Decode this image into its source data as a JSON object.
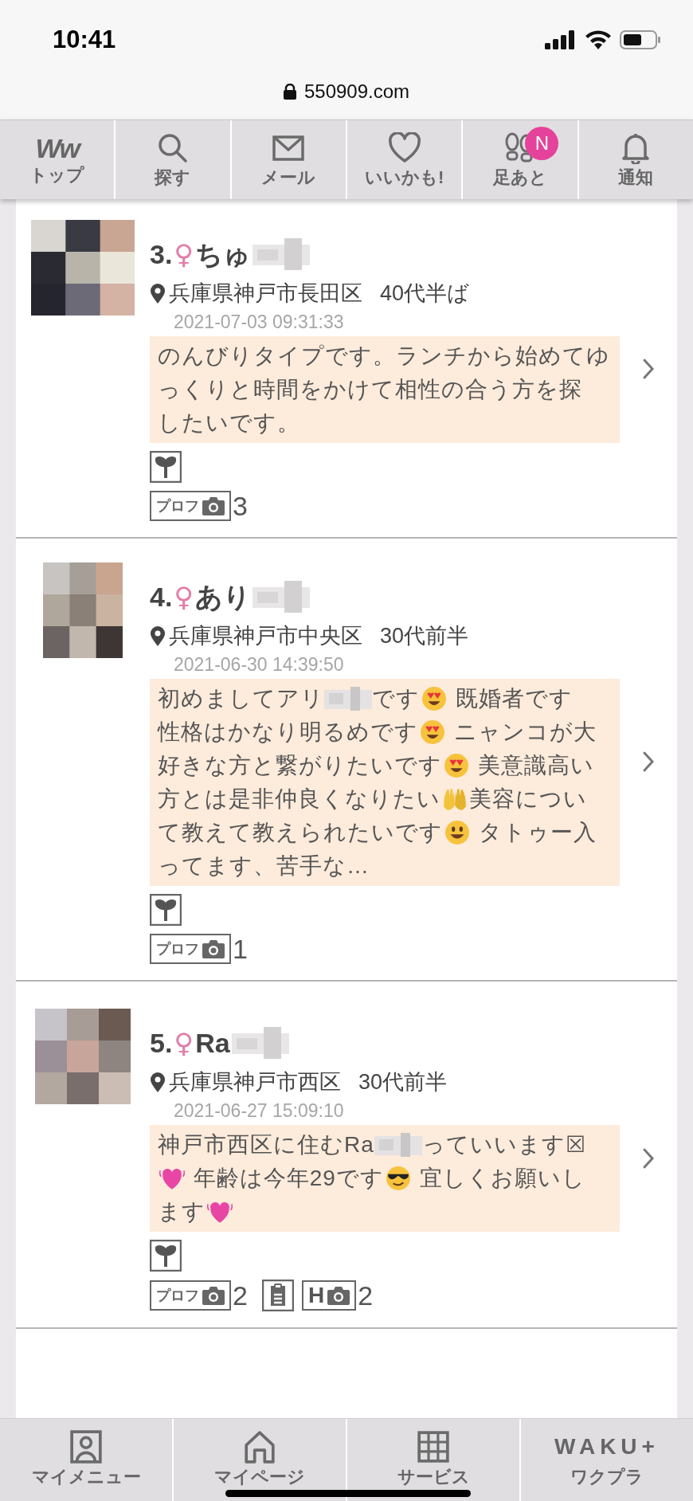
{
  "status_bar": {
    "time": "10:41"
  },
  "address_bar": {
    "url": "550909.com"
  },
  "nav": [
    {
      "kind": "logo",
      "logo": "Ww",
      "label": "トップ"
    },
    {
      "kind": "search",
      "label": "探す"
    },
    {
      "kind": "mail",
      "label": "メール"
    },
    {
      "kind": "heart",
      "label": "いいかも!"
    },
    {
      "kind": "footprints",
      "label": "足あと",
      "badge": "N"
    },
    {
      "kind": "bell",
      "label": "通知"
    }
  ],
  "profiles": [
    {
      "rank": "3.",
      "gender": "♀",
      "name": "ちゅ",
      "name_redacted": true,
      "location": "兵庫県神戸市長田区",
      "age": "40代半ば",
      "date": "2021-07-03 09:31:33",
      "message_lines": [
        [
          {
            "kind": "text",
            "text": "のんびりタイプです。ランチから始めてゆ"
          }
        ],
        [
          {
            "kind": "text",
            "text": "っくりと時間をかけて相性の合う方を探"
          }
        ],
        [
          {
            "kind": "text",
            "text": "したいです。"
          }
        ]
      ],
      "badge_rows": [
        [
          {
            "kind": "sprout"
          }
        ],
        [
          {
            "label": "プロフ",
            "count": "3"
          }
        ]
      ]
    },
    {
      "rank": "4.",
      "gender": "♀",
      "name": "あり",
      "name_redacted": true,
      "location": "兵庫県神戸市中央区",
      "age": "30代前半",
      "date": "2021-06-30 14:39:50",
      "message_lines": [
        [
          {
            "kind": "text",
            "text": "初めましてアリ"
          },
          {
            "kind": "blur"
          },
          {
            "kind": "text",
            "text": "です"
          },
          {
            "kind": "heart_eyes"
          },
          {
            "kind": "text",
            "text": " 既婚者です"
          }
        ],
        [
          {
            "kind": "text",
            "text": "性格はかなり明るめです"
          },
          {
            "kind": "heart_eyes"
          },
          {
            "kind": "text",
            "text": " ニャンコが大"
          }
        ],
        [
          {
            "kind": "text",
            "text": "好きな方と繋がりたいです"
          },
          {
            "kind": "heart_eyes"
          },
          {
            "kind": "text",
            "text": " 美意識高い"
          }
        ],
        [
          {
            "kind": "text",
            "text": "方とは是非仲良くなりたい"
          },
          {
            "kind": "raised_hands"
          },
          {
            "kind": "text",
            "text": "美容につい"
          }
        ],
        [
          {
            "kind": "text",
            "text": "て教えて教えられたいです"
          },
          {
            "kind": "smile"
          },
          {
            "kind": "text",
            "text": " タトゥー入"
          }
        ],
        [
          {
            "kind": "text",
            "text": "ってます、苦手な…"
          }
        ]
      ],
      "badge_rows": [
        [
          {
            "kind": "sprout"
          }
        ],
        [
          {
            "label": "プロフ",
            "count": "1"
          }
        ]
      ]
    },
    {
      "rank": "5.",
      "gender": "♀",
      "name": "Ra",
      "name_redacted": true,
      "location": "兵庫県神戸市西区",
      "age": "30代前半",
      "date": "2021-06-27 15:09:10",
      "message_lines": [
        [
          {
            "kind": "text",
            "text": "神戸市西区に住むRa"
          },
          {
            "kind": "blur"
          },
          {
            "kind": "text",
            "text": "っていいます☒"
          }
        ],
        [
          {
            "kind": "beating_heart"
          },
          {
            "kind": "text",
            "text": " 年齢は今年29です"
          },
          {
            "kind": "sunglasses"
          },
          {
            "kind": "text",
            "text": " 宜しくお願いし"
          }
        ],
        [
          {
            "kind": "text",
            "text": "ます"
          },
          {
            "kind": "beating_heart"
          }
        ]
      ],
      "badge_rows": [
        [
          {
            "kind": "sprout"
          }
        ],
        [
          {
            "label": "プロフ",
            "count": "2"
          },
          {
            "kind": "document"
          },
          {
            "label": "H",
            "count": "2"
          }
        ]
      ]
    }
  ],
  "bottom_nav": [
    {
      "kind": "person",
      "label": "マイメニュー"
    },
    {
      "kind": "home",
      "label": "マイページ"
    },
    {
      "kind": "grid",
      "label": "サービス"
    },
    {
      "kind": "logo",
      "logo": "WAKU+",
      "label": "ワクプラ"
    }
  ]
}
